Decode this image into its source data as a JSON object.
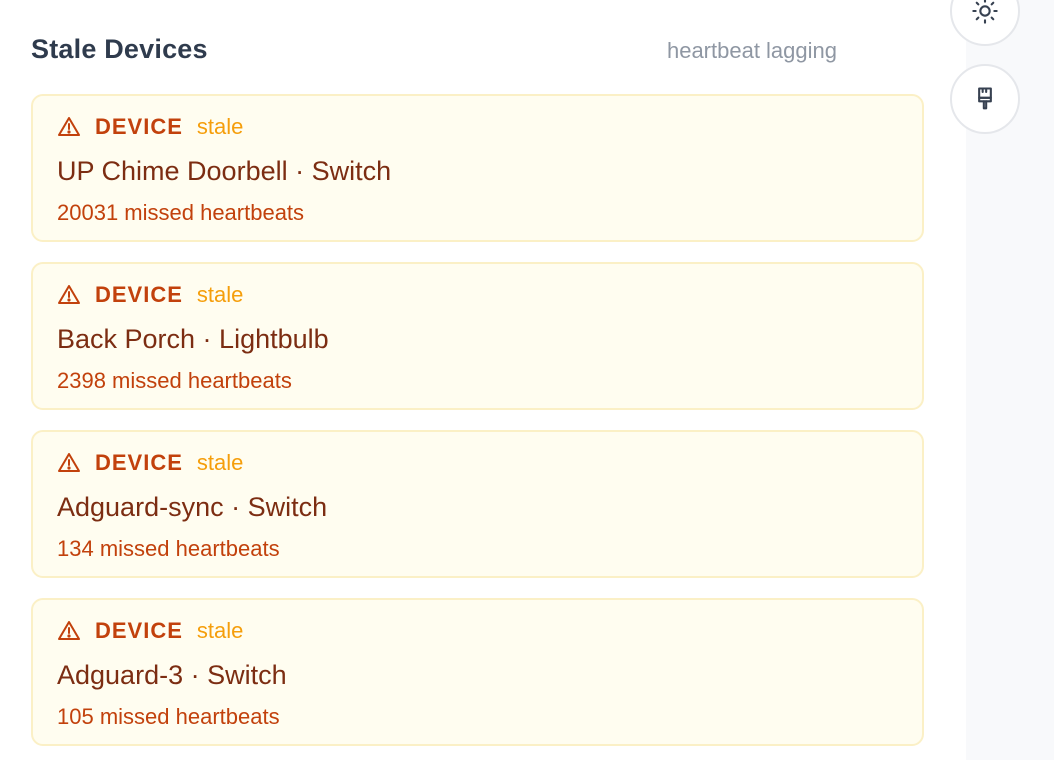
{
  "header": {
    "title": "Stale Devices",
    "subtitle": "heartbeat lagging"
  },
  "rail": {
    "buttons": [
      {
        "icon": "sun-icon"
      },
      {
        "icon": "paintbrush-icon"
      }
    ]
  },
  "items": [
    {
      "kind": "DEVICE",
      "status": "stale",
      "name": "UP Chime Doorbell · Switch",
      "missed": "20031 missed heartbeats"
    },
    {
      "kind": "DEVICE",
      "status": "stale",
      "name": "Back Porch · Lightbulb",
      "missed": "2398 missed heartbeats"
    },
    {
      "kind": "DEVICE",
      "status": "stale",
      "name": "Adguard-sync · Switch",
      "missed": "134 missed heartbeats"
    },
    {
      "kind": "DEVICE",
      "status": "stale",
      "name": "Adguard-3 · Switch",
      "missed": "105 missed heartbeats"
    }
  ],
  "colors": {
    "card_border": "#fbf0c6",
    "card_background": "#fffdf0",
    "kind": "#c2410c",
    "status": "#f59e0b",
    "name": "#7c2d12"
  }
}
